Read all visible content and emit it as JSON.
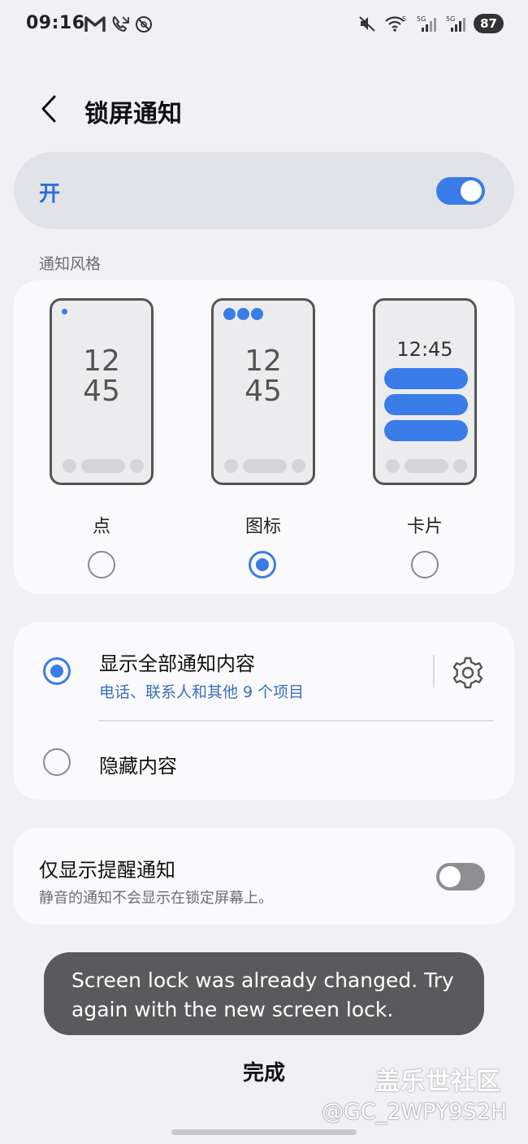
{
  "status_bar": {
    "time": "09:16",
    "battery": "87",
    "icons_left": [
      "gmail-icon",
      "missed-call-icon",
      "dnd-icon"
    ],
    "icons_right": [
      "mute-icon",
      "wifi-icon",
      "signal-5g-icon",
      "signal-5g-icon"
    ]
  },
  "header": {
    "title": "锁屏通知"
  },
  "master_switch": {
    "label": "开",
    "enabled": true
  },
  "notification_style": {
    "section_label": "通知风格",
    "options": [
      {
        "label": "点",
        "preview_time": [
          "12",
          "45"
        ],
        "selected": false
      },
      {
        "label": "图标",
        "preview_time": [
          "12",
          "45"
        ],
        "selected": true
      },
      {
        "label": "卡片",
        "preview_time": [
          "12:45"
        ],
        "selected": false
      }
    ]
  },
  "content_visibility": {
    "options": [
      {
        "title": "显示全部通知内容",
        "subtitle": "电话、联系人和其他 9 个项目",
        "selected": true
      },
      {
        "title": "隐藏内容",
        "selected": false
      }
    ]
  },
  "alert_only": {
    "title": "仅显示提醒通知",
    "subtitle": "静音的通知不会显示在锁定屏幕上。",
    "enabled": false
  },
  "toast": {
    "message": "Screen lock was already changed. Try again with the new screen lock."
  },
  "done_label": "完成",
  "watermark": {
    "brand": "盖乐世社区",
    "user": "@GC_2WPY9S2H"
  },
  "colors": {
    "accent": "#3a7ce8",
    "background": "#f1f1f5",
    "card": "#fafafc",
    "toast": "#5a5a5d"
  }
}
